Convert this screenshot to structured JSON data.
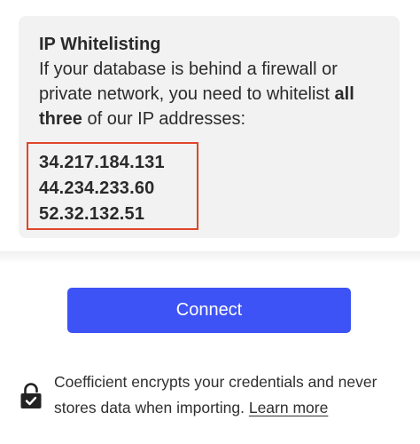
{
  "ip_card": {
    "title": "IP Whitelisting",
    "description_before": "If your database is behind a firewall or private network, you need to whitelist ",
    "description_bold": "all three",
    "description_after": " of our IP addresses:",
    "ip_addresses": [
      "34.217.184.131",
      "44.234.233.60",
      "52.32.132.51"
    ],
    "highlight_color": "#e0452a"
  },
  "connect": {
    "label": "Connect",
    "color": "#3d53f5"
  },
  "security_note": {
    "icon": "lock-icon",
    "text": "Coefficient encrypts your credentials and never stores data when importing. ",
    "link_label": "Learn more"
  }
}
